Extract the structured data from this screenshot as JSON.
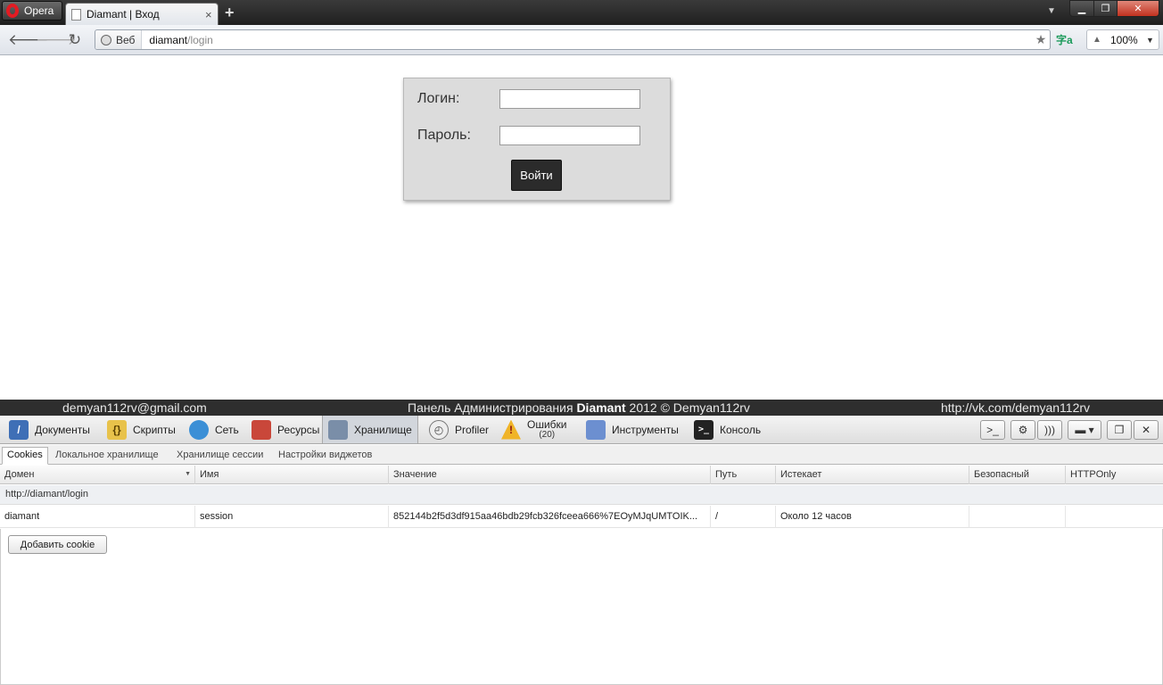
{
  "browser": {
    "menu_label": "Opera",
    "tab_title": "Diamant | Вход",
    "tab_close": "×",
    "new_tab": "+",
    "address": {
      "badge": "Веб",
      "host": "diamant",
      "path": "/login"
    },
    "zoom": "100%",
    "window_controls": {
      "minimize": "▁",
      "maximize": "❐",
      "close": "✕"
    }
  },
  "login_form": {
    "login_label": "Логин:",
    "login_value": "",
    "password_label": "Пароль:",
    "password_value": "",
    "submit_label": "Войти"
  },
  "footer": {
    "email": "demyan112rv@gmail.com",
    "center_prefix": "Панель Администрирования ",
    "center_brand": "Diamant",
    "center_suffix": " 2012 © Demyan112rv",
    "link": "http://vk.com/demyan112rv"
  },
  "devtools": {
    "tabs": {
      "documents": "Документы",
      "scripts": "Скрипты",
      "network": "Сеть",
      "resources": "Ресурсы",
      "storage": "Хранилище",
      "profiler": "Profiler",
      "errors": "Ошибки",
      "errors_count": "(20)",
      "tools": "Инструменты",
      "console": "Консоль"
    },
    "subtabs": {
      "cookies": "Cookies",
      "local_storage": "Локальное хранилище",
      "session_storage": "Хранилище сессии",
      "widget_settings": "Настройки виджетов"
    },
    "columns": {
      "domain": "Домен",
      "name": "Имя",
      "value": "Значение",
      "path": "Путь",
      "expires": "Истекает",
      "secure": "Безопасный",
      "httponly": "HTTPOnly"
    },
    "group": "http://diamant/login",
    "row": {
      "domain": "diamant",
      "name": "session",
      "value": "852144b2f5d3df915aa46bdb29fcb326fceea666%7EOyMJqUMTOIK...",
      "path": "/",
      "expires": "Около 12 часов",
      "secure": "",
      "httponly": ""
    },
    "add_cookie": "Добавить cookie"
  },
  "colors": {
    "titlebar": "#2a2a2a",
    "footer_bg": "#2e2e2e",
    "login_box": "#dcdcdc",
    "login_button": "#2b2b2b"
  }
}
